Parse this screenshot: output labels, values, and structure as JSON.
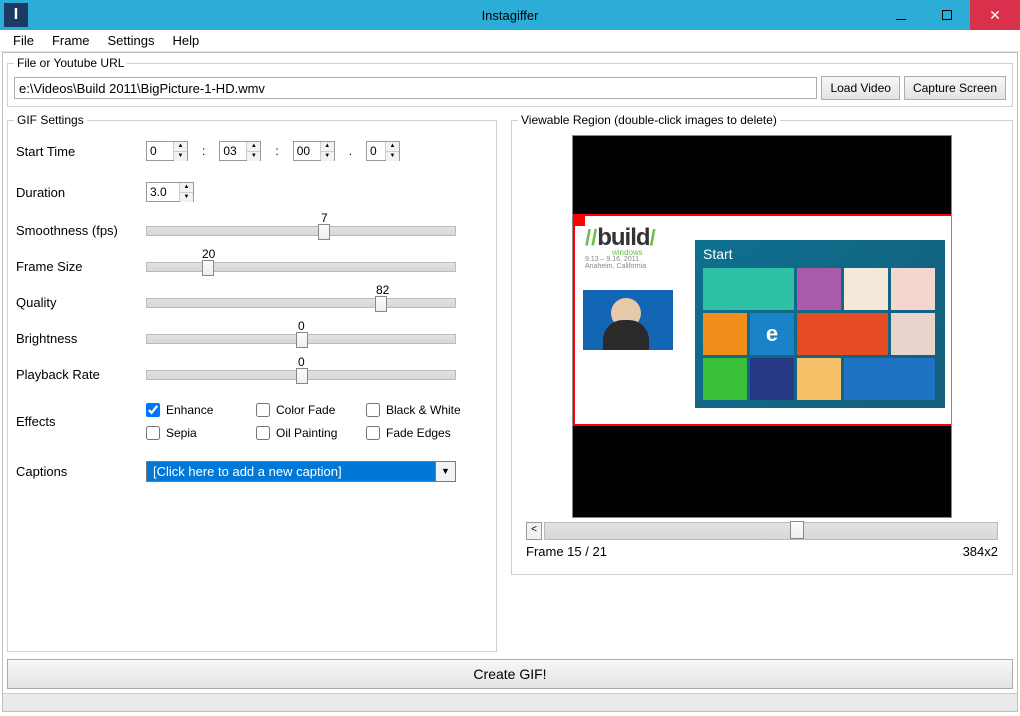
{
  "title": "Instagiffer",
  "menu": {
    "file": "File",
    "frame": "Frame",
    "settings": "Settings",
    "help": "Help"
  },
  "url_section": {
    "legend": "File or Youtube URL",
    "path": "e:\\Videos\\Build 2011\\BigPicture-1-HD.wmv",
    "load": "Load Video",
    "capture": "Capture Screen"
  },
  "settings": {
    "legend": "GIF Settings",
    "start_label": "Start Time",
    "start_h": "0",
    "start_m": "03",
    "start_s": "00",
    "start_ms": "0",
    "duration_label": "Duration",
    "duration": "3.0",
    "smoothness_label": "Smoothness (fps)",
    "smoothness": "7",
    "framesize_label": "Frame Size",
    "framesize": "20",
    "quality_label": "Quality",
    "quality": "82",
    "brightness_label": "Brightness",
    "brightness": "0",
    "playback_label": "Playback Rate",
    "playback": "0",
    "effects_label": "Effects",
    "eff_enhance": "Enhance",
    "eff_colorfade": "Color Fade",
    "eff_bw": "Black & White",
    "eff_sepia": "Sepia",
    "eff_oil": "Oil Painting",
    "eff_fade": "Fade Edges",
    "captions_label": "Captions",
    "captions_placeholder": "[Click here to add a new caption]"
  },
  "preview": {
    "legend": "Viewable Region (double-click images to delete)",
    "scroll_left": "<",
    "frame_info": "Frame  15 / 21",
    "dims": "384x2",
    "tiles_start": "Start",
    "build_dates": "9.13 – 9.16, 2011",
    "build_loc": "Anaheim, California",
    "build_word": "build",
    "build_win": "windows",
    "ie": "e"
  },
  "create_label": "Create GIF!"
}
